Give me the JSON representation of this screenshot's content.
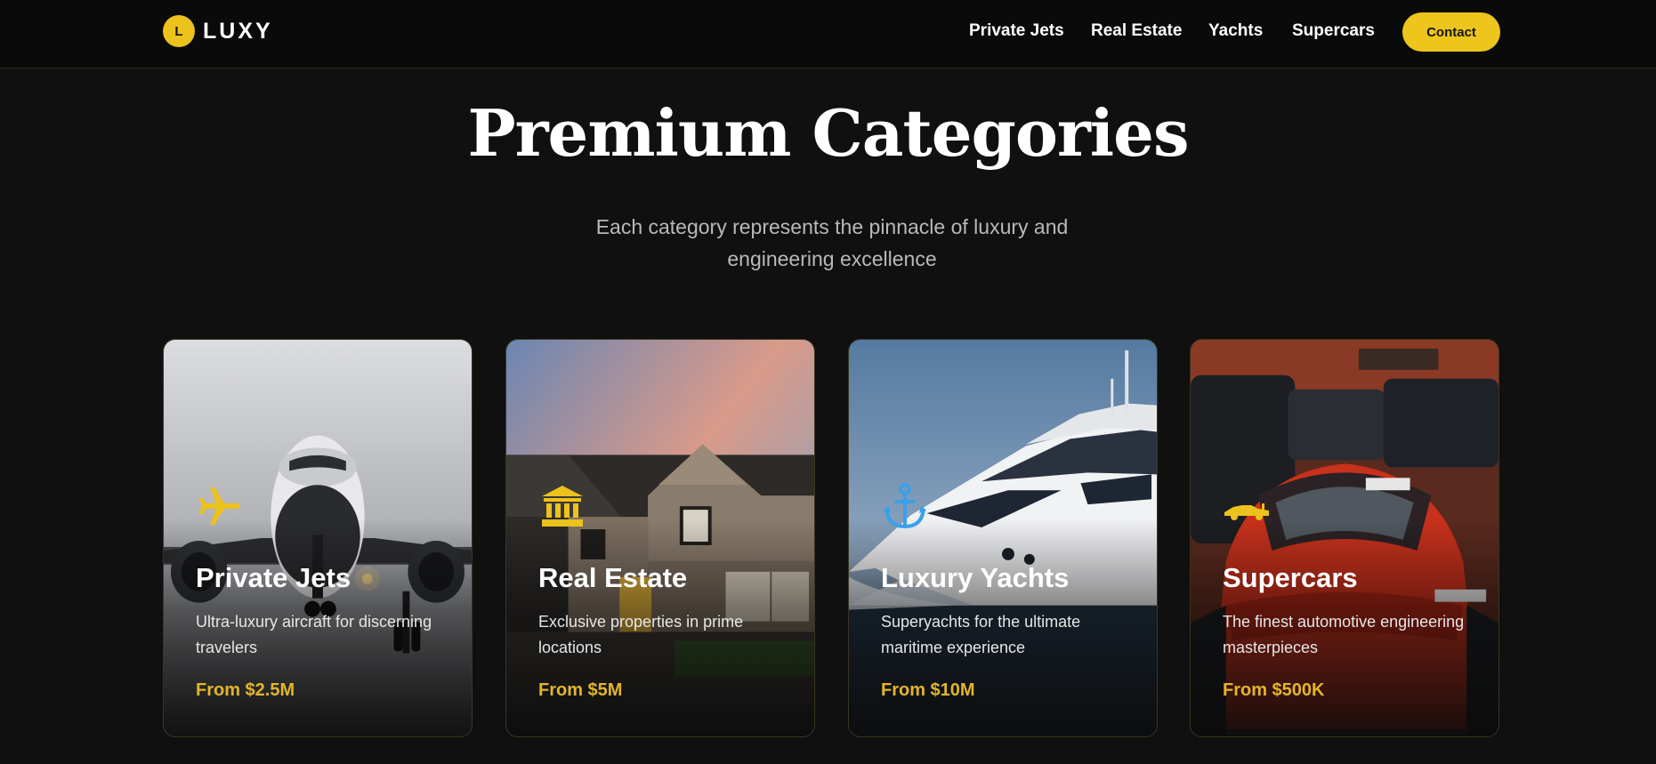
{
  "header": {
    "logo_letter": "L",
    "logo_text": "LUXY",
    "nav": [
      "Private Jets",
      "Real Estate",
      "Yachts",
      "Supercars"
    ],
    "contact_label": "Contact"
  },
  "hero": {
    "title": "Premium Categories",
    "subtitle": "Each category represents the pinnacle of luxury and engineering excellence"
  },
  "categories": [
    {
      "name": "Private Jets",
      "description": "Ultra-luxury aircraft for discerning travelers",
      "price": "From $2.5M",
      "icon": "airplane-icon"
    },
    {
      "name": "Real Estate",
      "description": "Exclusive properties in prime locations",
      "price": "From $5M",
      "icon": "bank-building-icon"
    },
    {
      "name": "Luxury Yachts",
      "description": "Superyachts for the ultimate maritime experience",
      "price": "From $10M",
      "icon": "anchor-icon"
    },
    {
      "name": "Supercars",
      "description": "The finest automotive engineering masterpieces",
      "price": "From $500K",
      "icon": "race-car-icon"
    }
  ],
  "colors": {
    "accent": "#ECC21C",
    "background": "#101010",
    "price": "#E3B52B",
    "anchor_icon": "#3AA0E8"
  }
}
